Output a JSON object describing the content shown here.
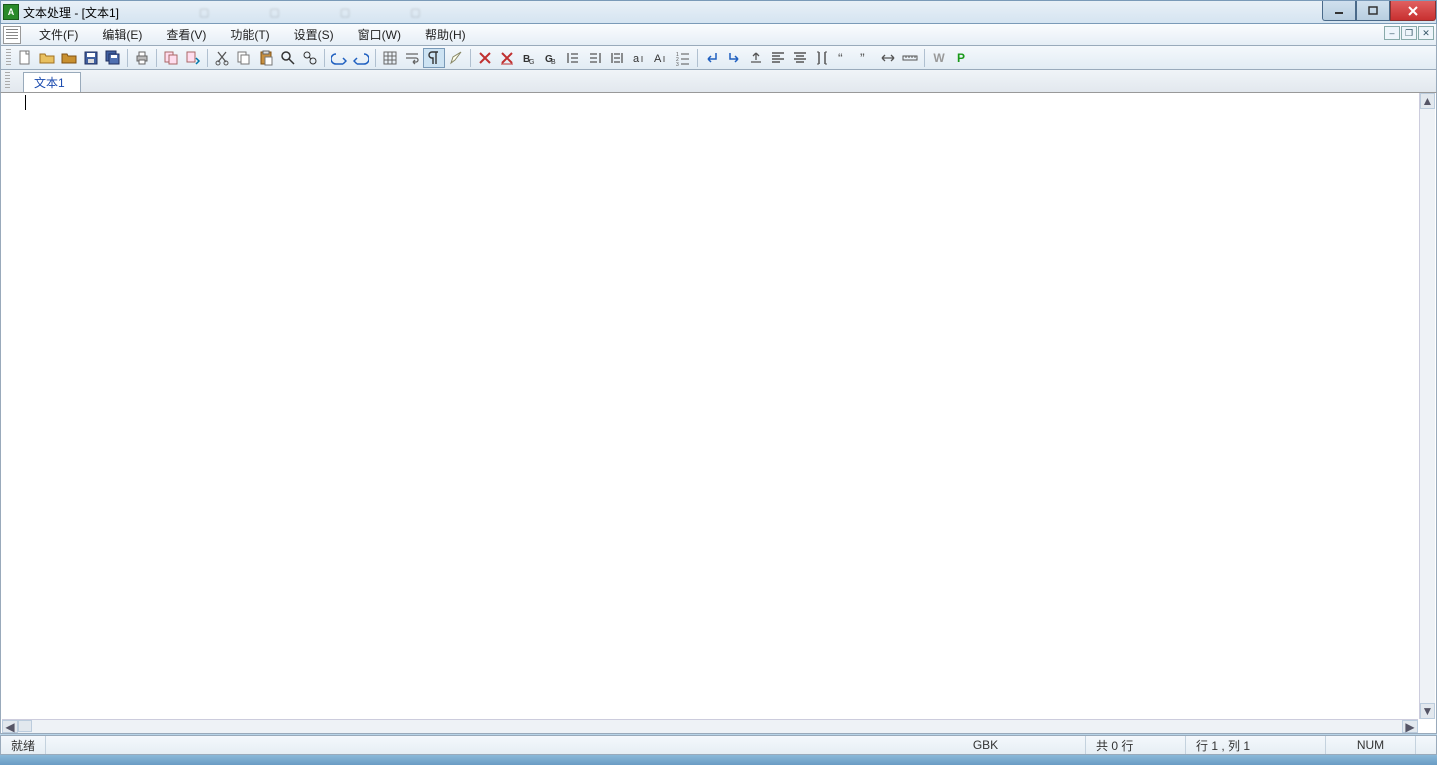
{
  "title": "文本处理 - [文本1]",
  "menu": {
    "file": "文件(F)",
    "edit": "编辑(E)",
    "view": "查看(V)",
    "func": "功能(T)",
    "set": "设置(S)",
    "window": "窗口(W)",
    "help": "帮助(H)"
  },
  "tabs": {
    "doc1": "文本1"
  },
  "status": {
    "ready": "就绪",
    "encoding": "GBK",
    "lines": "共 0 行",
    "pos": "行 1 , 列 1",
    "num": "NUM"
  },
  "toolbar_letters": {
    "w": "W",
    "p": "P"
  }
}
